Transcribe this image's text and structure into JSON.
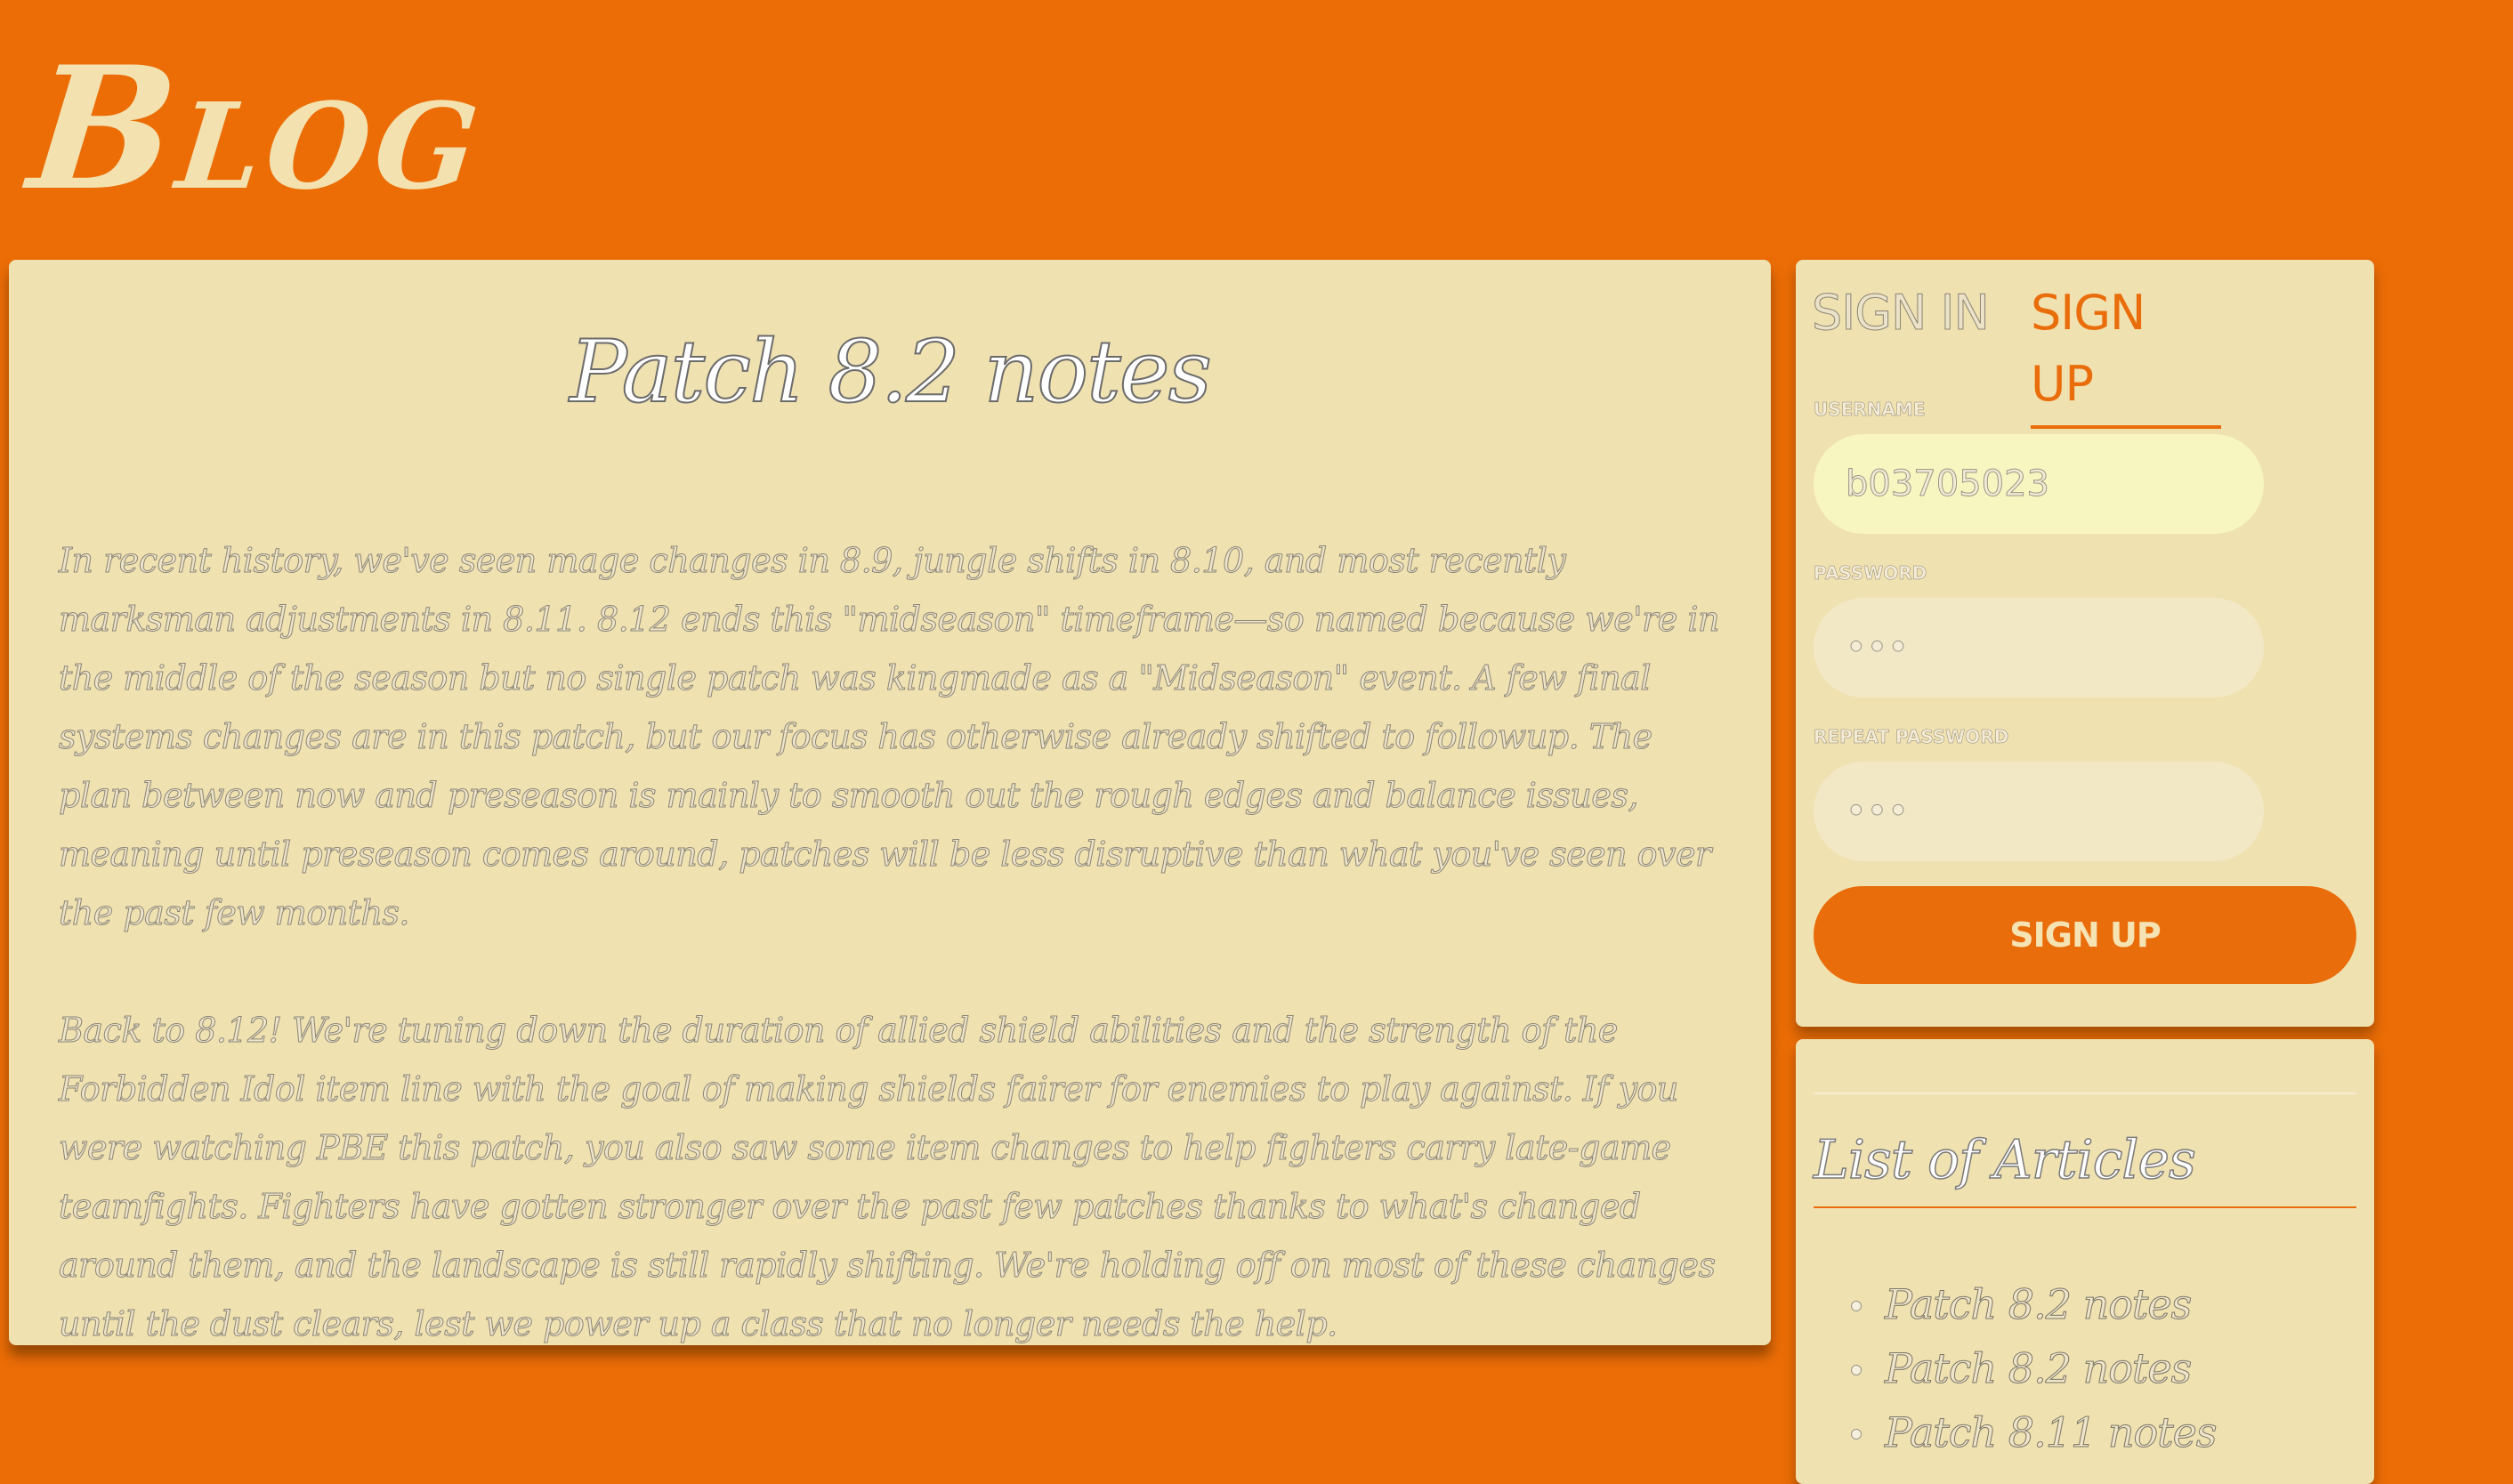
{
  "header": {
    "logo_text": "Blog"
  },
  "article": {
    "title": "Patch 8.2 notes",
    "paragraphs": [
      "In recent history, we've seen mage changes in 8.9, jungle shifts in 8.10, and most recently marksman adjustments in 8.11. 8.12 ends this \"midseason\" timeframe—so named because we're in the middle of the season but no single patch was kingmade as a \"Midseason\" event. A few final systems changes are in this patch, but our focus has otherwise already shifted to followup. The plan between now and preseason is mainly to smooth out the rough edges and balance issues, meaning until preseason comes around, patches will be less disruptive than what you've seen over the past few months.",
      "Back to 8.12! We're tuning down the duration of allied shield abilities and the strength of the Forbidden Idol item line with the goal of making shields fairer for enemies to play against. If you were watching PBE this patch, you also saw some item changes to help fighters carry late-game teamfights. Fighters have gotten stronger over the past few patches thanks to what's changed around them, and the landscape is still rapidly shifting. We're holding off on most of these changes until the dust clears, lest we power up a class that no longer needs the help."
    ]
  },
  "auth": {
    "tab_signin": "SIGN IN",
    "tab_signup": "SIGN UP",
    "username_label": "Username",
    "username_value": "b03705023",
    "password_label": "Password",
    "password_value": "•••",
    "repeat_password_label": "Repeat Password",
    "repeat_password_value": "•••",
    "submit_label": "SIGN UP"
  },
  "articles_panel": {
    "heading": "List of Articles",
    "items": [
      "Patch 8.2 notes",
      "Patch 8.2 notes",
      "Patch 8.11 notes"
    ]
  }
}
